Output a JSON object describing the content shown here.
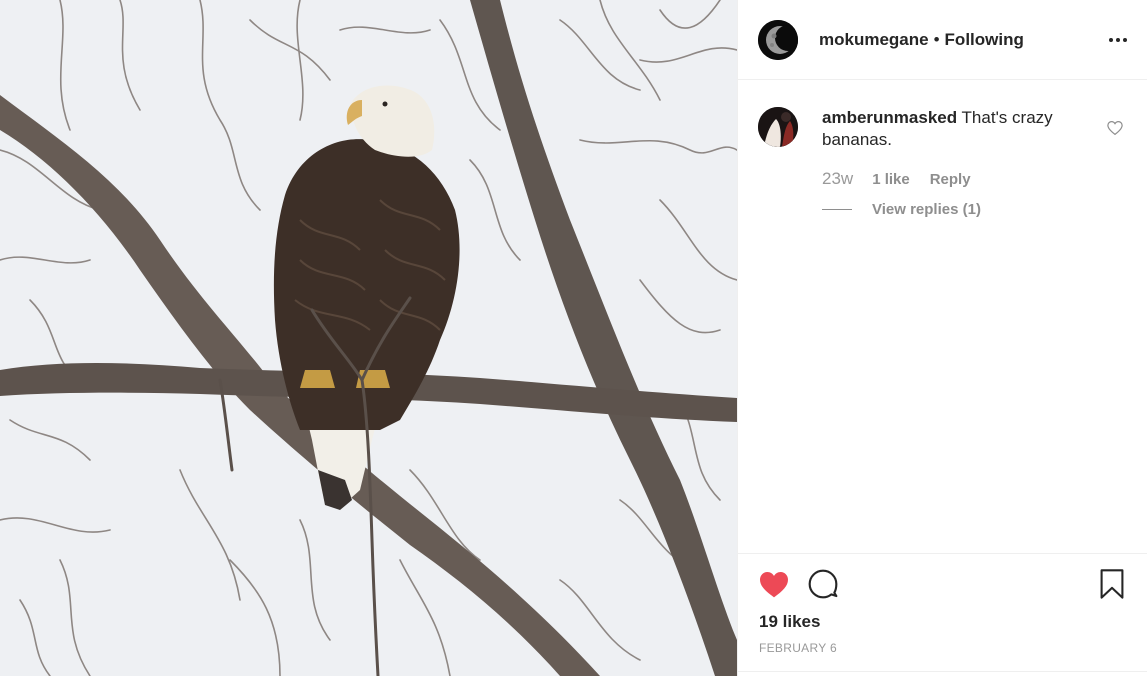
{
  "post": {
    "image_alt_subject": "bald-eagle-on-branch",
    "author": {
      "username": "mokumegane",
      "separator": "•",
      "follow_status": "Following"
    },
    "comments": [
      {
        "username": "amberunmasked",
        "text": "That's crazy bananas.",
        "time": "23w",
        "likes": "1 like",
        "reply_label": "Reply",
        "view_replies": "View replies (1)"
      }
    ],
    "likes": "19 likes",
    "date": "FEBRUARY 6"
  },
  "icons": {
    "more": "more-options-icon",
    "heart_liked": "heart-filled-icon",
    "comment": "comment-bubble-icon",
    "save": "bookmark-icon",
    "comment_like": "heart-outline-icon"
  },
  "colors": {
    "liked_heart": "#ed4956",
    "text_primary": "#262626",
    "text_secondary": "#8e8e8e"
  }
}
